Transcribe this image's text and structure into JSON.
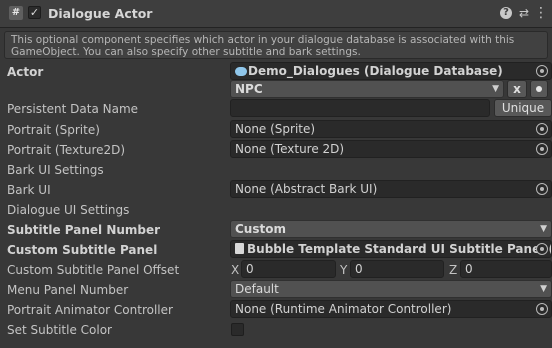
{
  "header": {
    "script_icon": "#",
    "enabled_check": "✓",
    "title": "Dialogue Actor",
    "help_icon": "?",
    "settings_icon": "⇄",
    "menu_icon": "⋮"
  },
  "help_text": "This optional component specifies which actor in your dialogue database is associated with this GameObject. You can also specify other subtitle and bark settings.",
  "actor": {
    "label": "Actor",
    "database": "Demo_Dialogues (Dialogue Database)",
    "selected": "NPC",
    "clear_label": "x"
  },
  "persistent": {
    "label": "Persistent Data Name",
    "value": "",
    "unique_label": "Unique"
  },
  "portrait_sprite": {
    "label": "Portrait (Sprite)",
    "value": "None (Sprite)"
  },
  "portrait_texture": {
    "label": "Portrait (Texture2D)",
    "value": "None (Texture 2D)"
  },
  "bark_ui_settings": {
    "label": "Bark UI Settings"
  },
  "bark_ui": {
    "label": "Bark UI",
    "value": "None (Abstract Bark UI)"
  },
  "dialogue_ui_settings": {
    "label": "Dialogue UI Settings"
  },
  "subtitle_panel_number": {
    "label": "Subtitle Panel Number",
    "value": "Custom"
  },
  "custom_subtitle_panel": {
    "label": "Custom Subtitle Panel",
    "value": "Bubble Template Standard UI Subtitle Panel (Standard UI Subtitle Panel)"
  },
  "offset": {
    "label": "Custom Subtitle Panel Offset",
    "x_label": "X",
    "x": "0",
    "y_label": "Y",
    "y": "0",
    "z_label": "Z",
    "z": "0"
  },
  "menu_panel_number": {
    "label": "Menu Panel Number",
    "value": "Default"
  },
  "portrait_animator": {
    "label": "Portrait Animator Controller",
    "value": "None (Runtime Animator Controller)"
  },
  "set_subtitle_color": {
    "label": "Set Subtitle Color",
    "checked": false
  },
  "colors": {
    "background": "#383838",
    "field": "#2a2a2a",
    "dropdown": "#515151",
    "header": "#3e3e3e"
  }
}
